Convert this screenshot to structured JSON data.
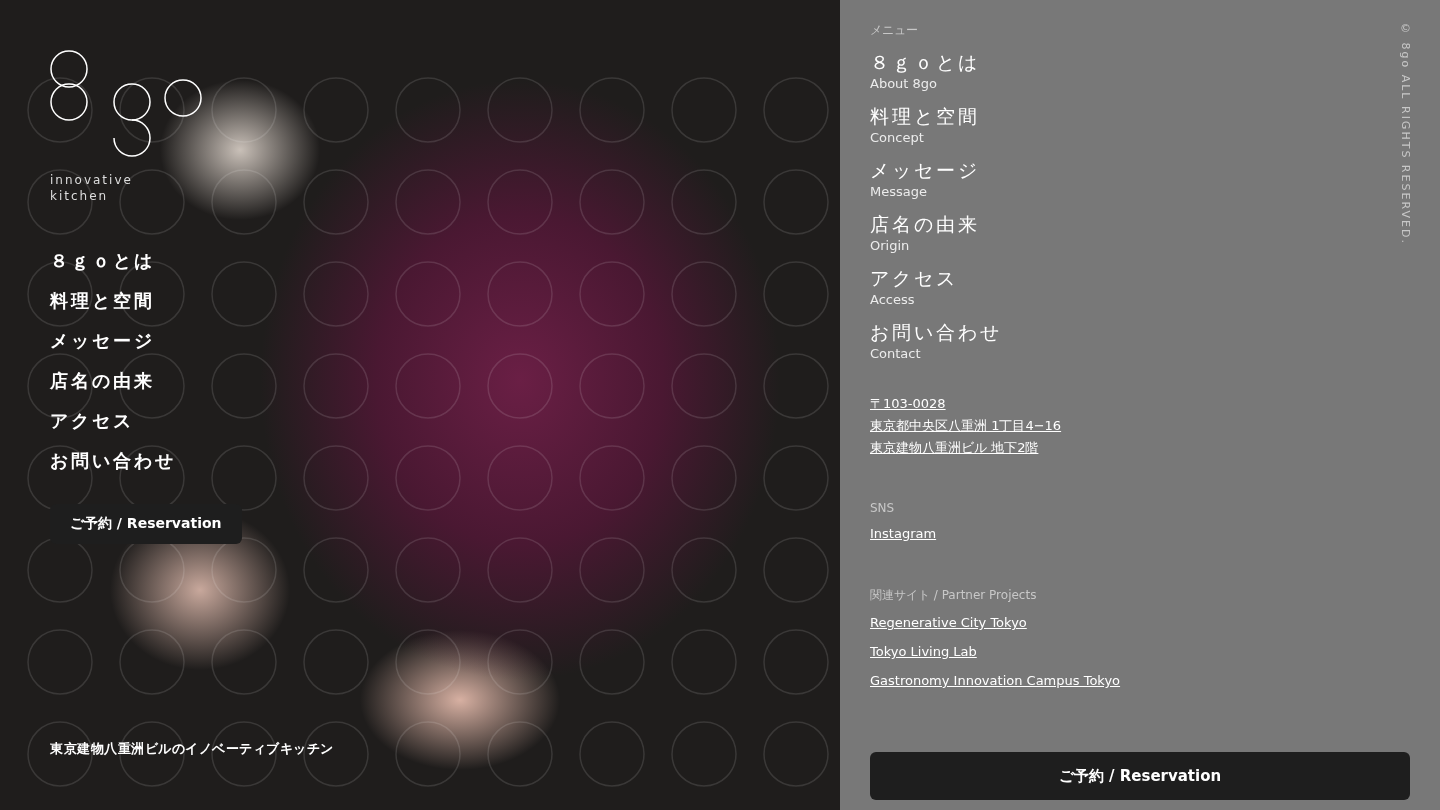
{
  "hero": {
    "logo_caption": [
      "innovative",
      "kitchen"
    ],
    "nav": [
      "８ｇｏとは",
      "料理と空間",
      "メッセージ",
      "店名の由来",
      "アクセス",
      "お問い合わせ"
    ],
    "reserve_button": "ご予約 / Reservation",
    "tagline": "東京建物八重洲ビルのイノベーティブキッチン"
  },
  "menu": {
    "heading": "メニュー",
    "items": [
      {
        "ja": "８ｇｏとは",
        "en": "About 8go"
      },
      {
        "ja": "料理と空間",
        "en": "Concept"
      },
      {
        "ja": "メッセージ",
        "en": "Message"
      },
      {
        "ja": "店名の由来",
        "en": "Origin"
      },
      {
        "ja": "アクセス",
        "en": "Access"
      },
      {
        "ja": "お問い合わせ",
        "en": "Contact"
      }
    ],
    "address": [
      "〒103-0028",
      "東京都中央区八重洲 1丁目4−16",
      "東京建物八重洲ビル 地下2階"
    ],
    "sns_heading": "SNS",
    "sns_links": [
      "Instagram"
    ],
    "partners_heading": "関連サイト / Partner Projects",
    "partner_links": [
      "Regenerative City Tokyo",
      "Tokyo Living Lab",
      "Gastronomy Innovation Campus Tokyo"
    ],
    "reserve_button": "ご予約 / Reservation",
    "copyright": "© 8go ALL RIGHTS RESERVED."
  }
}
